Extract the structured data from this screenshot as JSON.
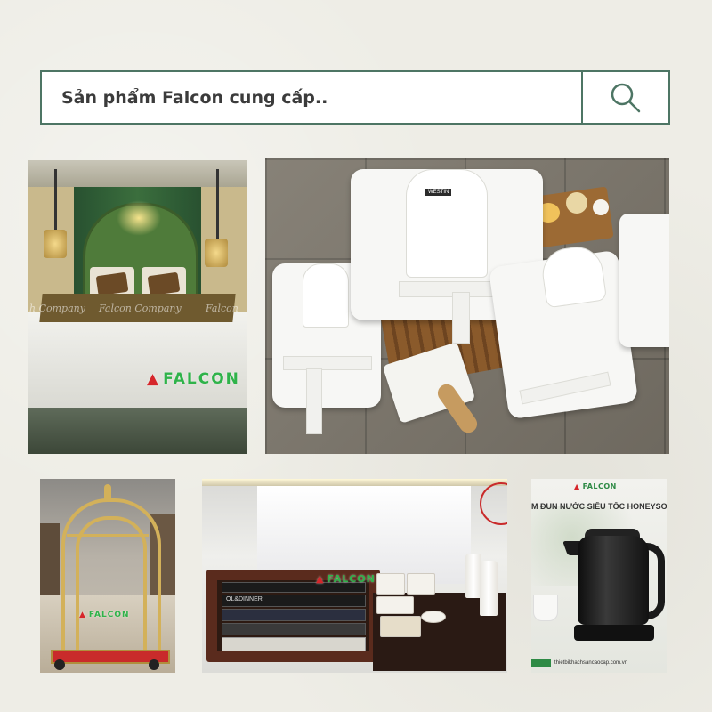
{
  "search": {
    "text": "Sản phẩm Falcon cung cấp..",
    "icon": "search-icon",
    "border_color": "#4d7564"
  },
  "photos": {
    "bedroom": {
      "watermark_left": "h Company",
      "watermark_right": "Falcon Company",
      "watermark_far": "Falcon",
      "logo": "FALCON"
    },
    "robes": {
      "label": "WESTIN"
    },
    "cart": {
      "logo": "FALCON"
    },
    "amenities": {
      "logo": "FALCON",
      "pack_text": "OL&DINNER"
    },
    "kettle": {
      "logo": "FALCON",
      "banner": "M ĐUN NƯỚC SIÊU TỐC HONEYSO",
      "website": "thietbikhachsancaocap.com.vn"
    }
  },
  "colors": {
    "background": "#eeede6",
    "accent_green": "#2fb34a",
    "logo_red": "#d6262b"
  }
}
